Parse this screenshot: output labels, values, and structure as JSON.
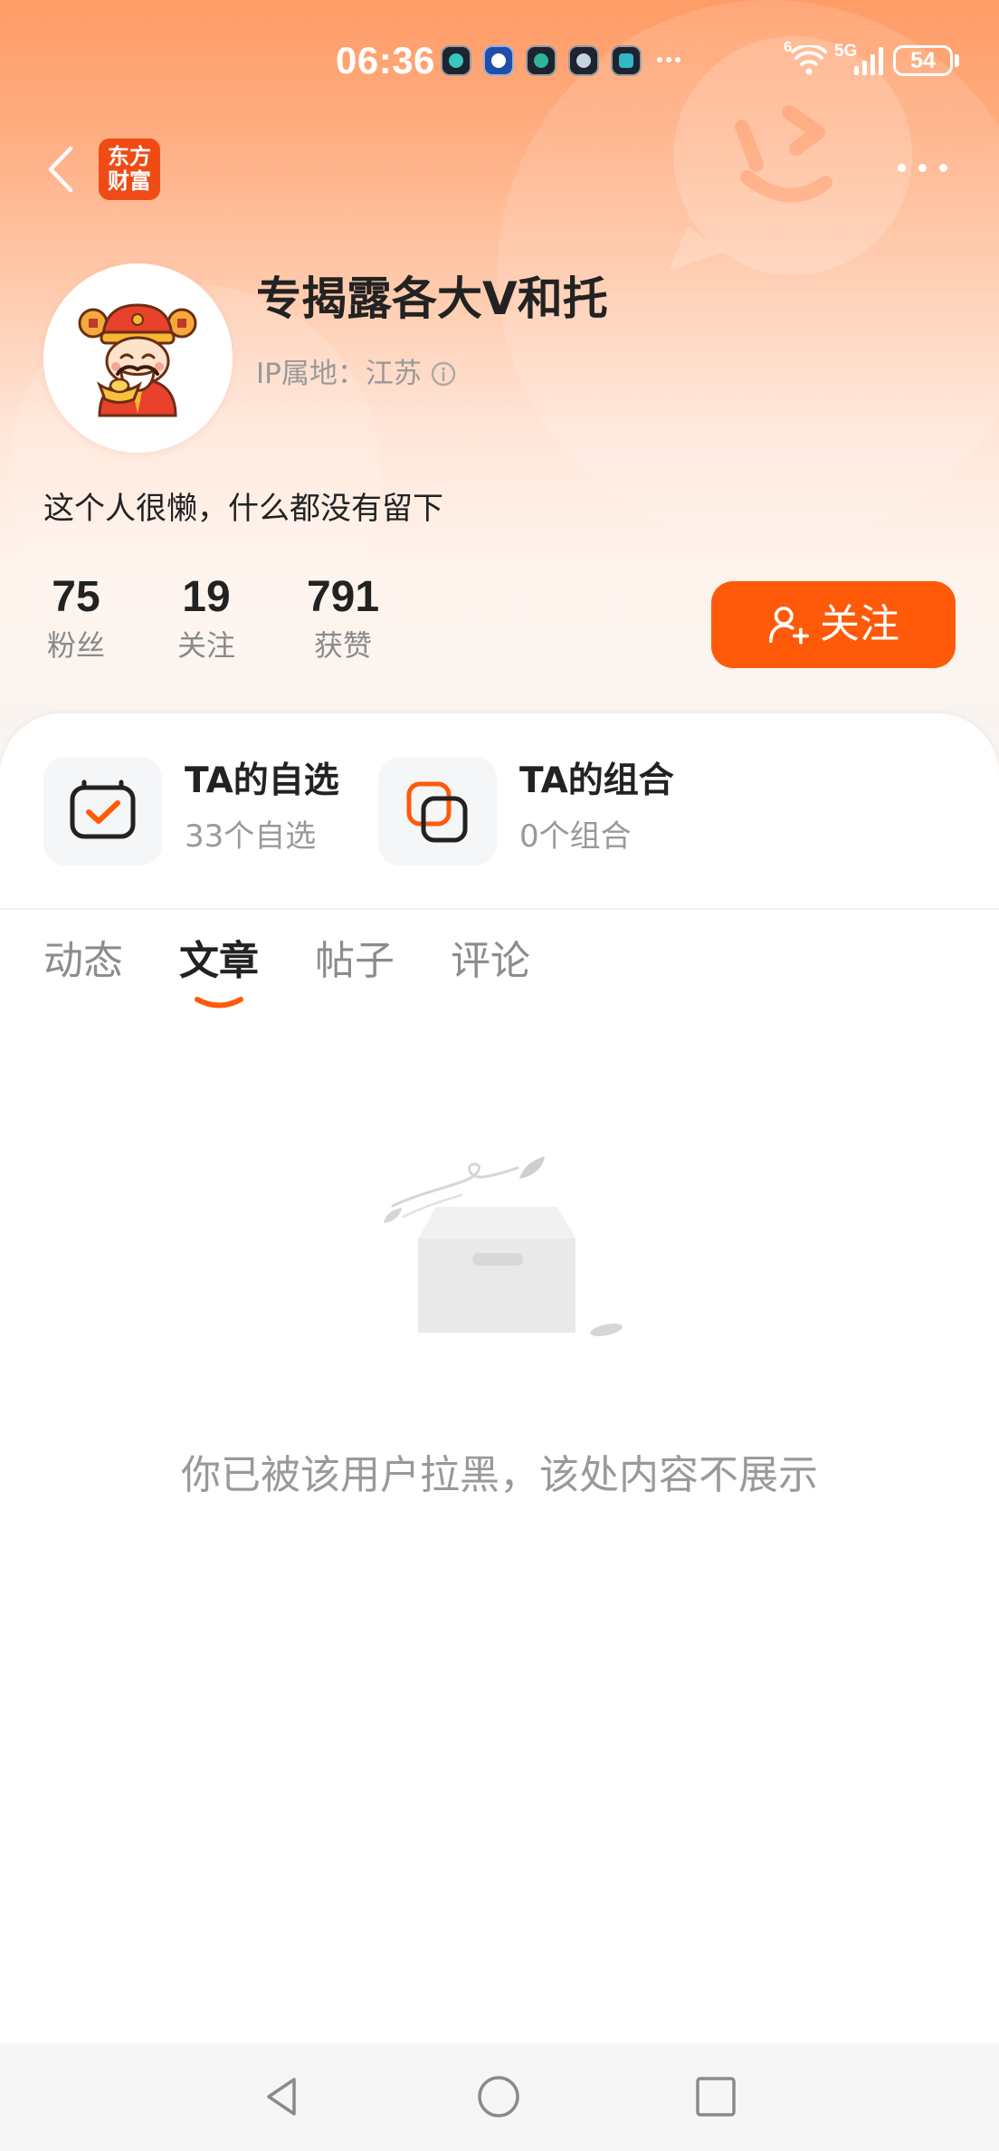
{
  "status_bar": {
    "time": "06:36",
    "app_icons": [
      "notification-app-icon-1",
      "notification-app-icon-2",
      "notification-app-icon-3",
      "notification-app-icon-4",
      "notification-app-icon-5"
    ],
    "wifi_badge": "6",
    "network": "5G",
    "battery": "54"
  },
  "header": {
    "back_icon": "chevron-left-icon",
    "logo_line1": "东方",
    "logo_line2": "财富",
    "more_icon": "more-dots-icon"
  },
  "profile": {
    "name": "专揭露各大V和托",
    "ip_location": "IP属地：江苏",
    "bio": "这个人很懒，什么都没有留下",
    "stats": [
      {
        "value": "75",
        "label": "粉丝"
      },
      {
        "value": "19",
        "label": "关注"
      },
      {
        "value": "791",
        "label": "获赞"
      }
    ],
    "follow_button": "关注"
  },
  "shortcuts": [
    {
      "title": "TA的自选",
      "subtitle": "33个自选",
      "icon": "watchlist-icon"
    },
    {
      "title": "TA的组合",
      "subtitle": "0个组合",
      "icon": "portfolio-icon"
    }
  ],
  "tabs": [
    {
      "label": "动态",
      "active": false
    },
    {
      "label": "文章",
      "active": true
    },
    {
      "label": "帖子",
      "active": false
    },
    {
      "label": "评论",
      "active": false
    }
  ],
  "empty_state": {
    "illustration": "empty-box-illustration",
    "message": "你已被该用户拉黑，该处内容不展示"
  },
  "nav_bar": {
    "icons": [
      "back-triangle-icon",
      "home-circle-icon",
      "recents-square-icon"
    ]
  },
  "colors": {
    "accent": "#FF5A0A",
    "logo_bg": "#F04B14",
    "text_primary": "#222222",
    "text_secondary": "#999999",
    "tab_inactive": "#8C8C8C"
  }
}
